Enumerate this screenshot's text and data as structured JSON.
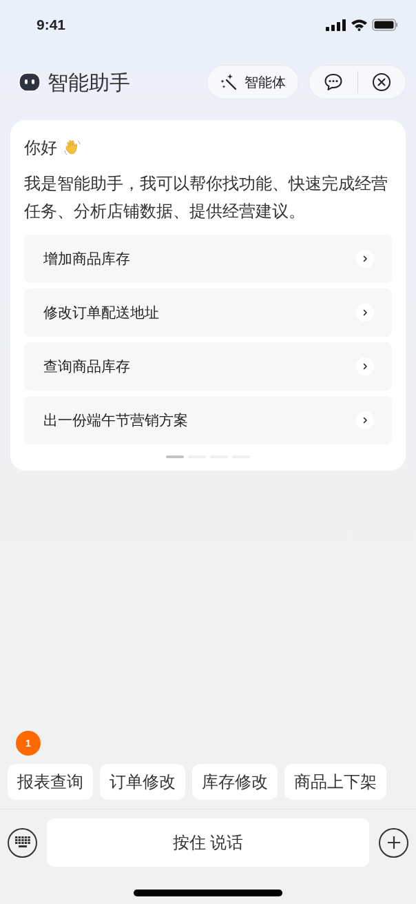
{
  "status_bar": {
    "time": "9:41"
  },
  "header": {
    "title": "智能助手",
    "agent_button": "智能体"
  },
  "welcome": {
    "greeting": "你好",
    "message": "我是智能助手，我可以帮你找功能、快速完成经营任务、分析店铺数据、提供经营建议。",
    "suggestions": [
      "增加商品库存",
      "修改订单配送地址",
      "查询商品库存",
      "出一份端午节营销方案"
    ],
    "pages": [
      {
        "selected": true
      },
      {
        "selected": false
      },
      {
        "selected": false
      },
      {
        "selected": false
      }
    ]
  },
  "badge": "1",
  "quick_actions": [
    "报表查询",
    "订单修改",
    "库存修改",
    "商品上下架"
  ],
  "input": {
    "hold_to_talk": "按住 说话"
  }
}
